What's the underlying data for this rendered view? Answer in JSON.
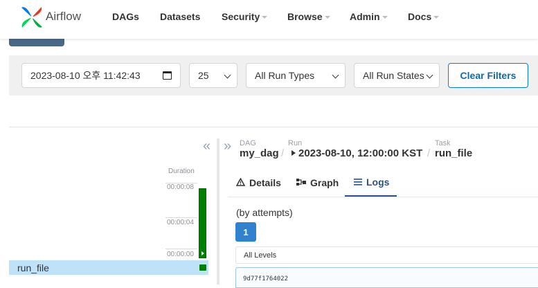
{
  "nav": {
    "brand": "Airflow",
    "items": [
      "DAGs",
      "Datasets",
      "Security",
      "Browse",
      "Admin",
      "Docs"
    ]
  },
  "filters": {
    "base_date": "2023-08-10 오후 11:42:43",
    "num_runs": "25",
    "run_type": "All Run Types",
    "run_state": "All Run States",
    "clear_label": "Clear Filters"
  },
  "grid": {
    "collapse_icon": "«",
    "duration_header": "Duration",
    "ticks": [
      "00:00:08",
      "00:00:04",
      "00:00:00"
    ],
    "task": "run_file",
    "run_state": "success",
    "run_duration_fraction": 0.95
  },
  "details": {
    "expand_icon": "»",
    "breadcrumb": {
      "dag_label": "DAG",
      "dag": "my_dag",
      "run_label": "Run",
      "run": "2023-08-10, 12:00:00 KST",
      "task_label": "Task",
      "task": "run_file",
      "sep": "/"
    },
    "tabs": [
      "Details",
      "Graph",
      "Logs"
    ],
    "active_tab": "Logs",
    "attempts_label": "(by attempts)",
    "attempt": "1",
    "levels": "All Levels",
    "log_line": "9d77f1764022"
  },
  "colors": {
    "success": "#008000",
    "accent": "#3182ce",
    "selected_row": "#bee3f8"
  }
}
